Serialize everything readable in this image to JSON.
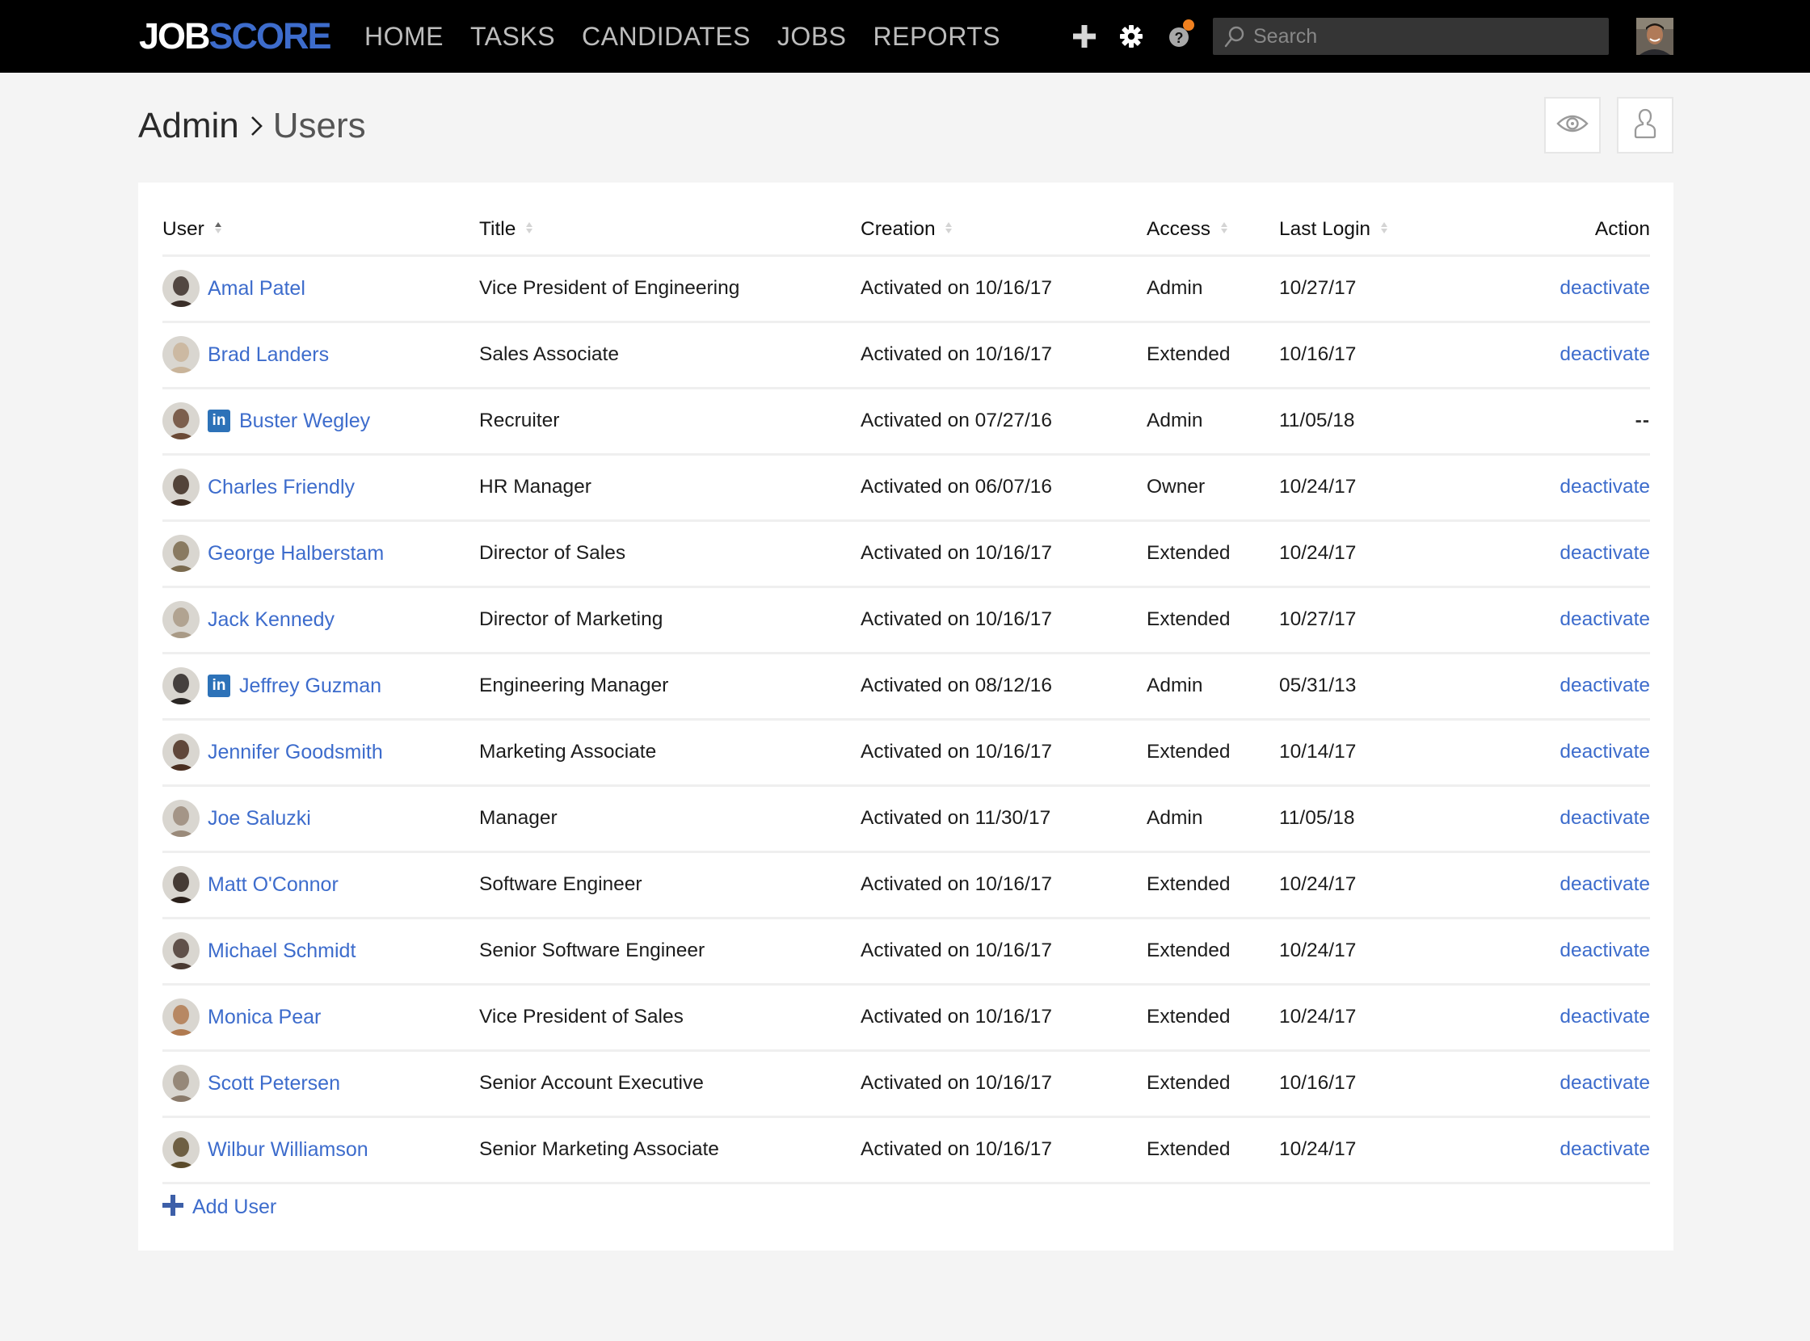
{
  "app": {
    "brand": {
      "part1": "JOB",
      "part2": "SCORE"
    },
    "colors": {
      "brand_blue": "#3d6ccc",
      "link": "#3d6ccc",
      "notification": "#f0801f",
      "linkedin": "#2d72b8",
      "topbar": "#000000"
    }
  },
  "topnav": {
    "items": [
      {
        "label": "HOME"
      },
      {
        "label": "TASKS"
      },
      {
        "label": "CANDIDATES"
      },
      {
        "label": "JOBS"
      },
      {
        "label": "REPORTS"
      }
    ],
    "icons": [
      "plus-icon",
      "gear-icon",
      "help-icon"
    ],
    "search": {
      "placeholder": "Search",
      "value": ""
    }
  },
  "header": {
    "breadcrumb": {
      "parent": "Admin",
      "current": "Users"
    },
    "buttons": [
      {
        "icon": "eye-icon"
      },
      {
        "icon": "user-icon"
      }
    ]
  },
  "table": {
    "columns": [
      {
        "label": "User",
        "sortable": true,
        "sorted": "asc"
      },
      {
        "label": "Title",
        "sortable": true
      },
      {
        "label": "Creation",
        "sortable": true
      },
      {
        "label": "Access",
        "sortable": true
      },
      {
        "label": "Last Login",
        "sortable": true
      },
      {
        "label": "Action",
        "sortable": false
      }
    ],
    "rows": [
      {
        "name": "Amal Patel",
        "linkedin": false,
        "title": "Vice President of Engineering",
        "creation": "Activated on 10/16/17",
        "access": "Admin",
        "last_login": "10/27/17",
        "action": "deactivate",
        "avatar_color": "#3a2e28"
      },
      {
        "name": "Brad Landers",
        "linkedin": false,
        "title": "Sales Associate",
        "creation": "Activated on 10/16/17",
        "access": "Extended",
        "last_login": "10/16/17",
        "action": "deactivate",
        "avatar_color": "#c9b49a"
      },
      {
        "name": "Buster Wegley",
        "linkedin": true,
        "title": "Recruiter",
        "creation": "Activated on 07/27/16",
        "access": "Admin",
        "last_login": "11/05/18",
        "action": "--",
        "avatar_color": "#6b4a36"
      },
      {
        "name": "Charles Friendly",
        "linkedin": false,
        "title": "HR Manager",
        "creation": "Activated on 06/07/16",
        "access": "Owner",
        "last_login": "10/24/17",
        "action": "deactivate",
        "avatar_color": "#3b2a20"
      },
      {
        "name": "George Halberstam",
        "linkedin": false,
        "title": "Director of Sales",
        "creation": "Activated on 10/16/17",
        "access": "Extended",
        "last_login": "10/24/17",
        "action": "deactivate",
        "avatar_color": "#7a6a4e"
      },
      {
        "name": "Jack Kennedy",
        "linkedin": false,
        "title": "Director of Marketing",
        "creation": "Activated on 10/16/17",
        "access": "Extended",
        "last_login": "10/27/17",
        "action": "deactivate",
        "avatar_color": "#a99a86"
      },
      {
        "name": "Jeffrey Guzman",
        "linkedin": true,
        "title": "Engineering Manager",
        "creation": "Activated on 08/12/16",
        "access": "Admin",
        "last_login": "05/31/13",
        "action": "deactivate",
        "avatar_color": "#2a2624"
      },
      {
        "name": "Jennifer Goodsmith",
        "linkedin": false,
        "title": "Marketing Associate",
        "creation": "Activated on 10/16/17",
        "access": "Extended",
        "last_login": "10/14/17",
        "action": "deactivate",
        "avatar_color": "#4a2e20"
      },
      {
        "name": "Joe Saluzki",
        "linkedin": false,
        "title": "Manager",
        "creation": "Activated on 11/30/17",
        "access": "Admin",
        "last_login": "11/05/18",
        "action": "deactivate",
        "avatar_color": "#9a8a7a"
      },
      {
        "name": "Matt O'Connor",
        "linkedin": false,
        "title": "Software Engineer",
        "creation": "Activated on 10/16/17",
        "access": "Extended",
        "last_login": "10/24/17",
        "action": "deactivate",
        "avatar_color": "#2a201a"
      },
      {
        "name": "Michael Schmidt",
        "linkedin": false,
        "title": "Senior Software Engineer",
        "creation": "Activated on 10/16/17",
        "access": "Extended",
        "last_login": "10/24/17",
        "action": "deactivate",
        "avatar_color": "#4a3a32"
      },
      {
        "name": "Monica Pear",
        "linkedin": false,
        "title": "Vice President of Sales",
        "creation": "Activated on 10/16/17",
        "access": "Extended",
        "last_login": "10/24/17",
        "action": "deactivate",
        "avatar_color": "#b07a50"
      },
      {
        "name": "Scott Petersen",
        "linkedin": false,
        "title": "Senior Account Executive",
        "creation": "Activated on 10/16/17",
        "access": "Extended",
        "last_login": "10/16/17",
        "action": "deactivate",
        "avatar_color": "#8a7a6a"
      },
      {
        "name": "Wilbur Williamson",
        "linkedin": false,
        "title": "Senior Marketing Associate",
        "creation": "Activated on 10/16/17",
        "access": "Extended",
        "last_login": "10/24/17",
        "action": "deactivate",
        "avatar_color": "#5a4a2a"
      }
    ],
    "add_user_label": "Add User",
    "linkedin_label": "in"
  }
}
